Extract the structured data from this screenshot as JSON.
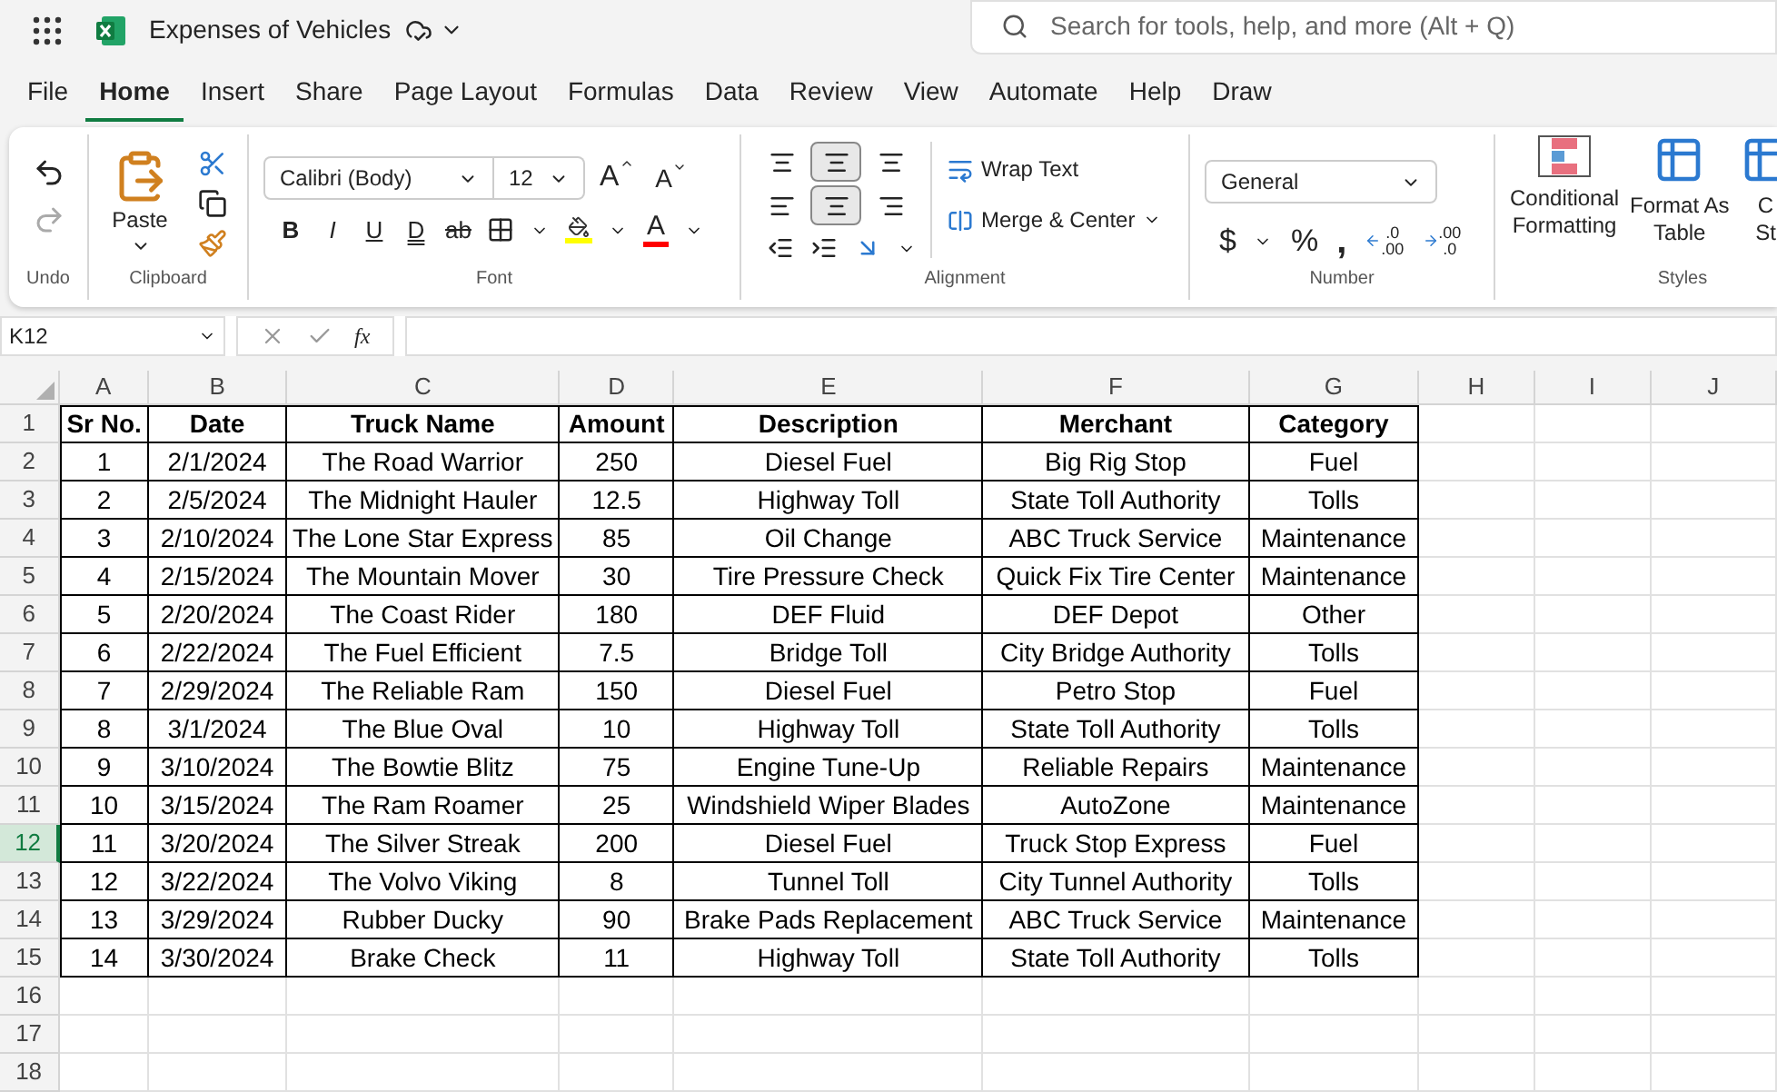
{
  "app": {
    "title": "Expenses of Vehicles"
  },
  "search": {
    "placeholder": "Search for tools, help, and more (Alt + Q)"
  },
  "menu_tabs": [
    {
      "label": "File",
      "selected": false
    },
    {
      "label": "Home",
      "selected": true
    },
    {
      "label": "Insert",
      "selected": false
    },
    {
      "label": "Share",
      "selected": false
    },
    {
      "label": "Page Layout",
      "selected": false
    },
    {
      "label": "Formulas",
      "selected": false
    },
    {
      "label": "Data",
      "selected": false
    },
    {
      "label": "Review",
      "selected": false
    },
    {
      "label": "View",
      "selected": false
    },
    {
      "label": "Automate",
      "selected": false
    },
    {
      "label": "Help",
      "selected": false
    },
    {
      "label": "Draw",
      "selected": false
    }
  ],
  "ribbon": {
    "undo": {
      "label": "Undo"
    },
    "clipboard": {
      "label": "Clipboard",
      "paste": "Paste"
    },
    "font": {
      "label": "Font",
      "font_name": "Calibri (Body)",
      "font_size": "12",
      "grow": "A",
      "shrink": "A",
      "styles": [
        "B",
        "I",
        "U",
        "D",
        "ab"
      ],
      "font_color": "A"
    },
    "alignment": {
      "label": "Alignment",
      "vertical": [
        {
          "selected": false
        },
        {
          "selected": true
        },
        {
          "selected": false
        }
      ],
      "horizontal": [
        {
          "selected": false
        },
        {
          "selected": true
        },
        {
          "selected": false
        }
      ],
      "wrap_text": "Wrap Text",
      "merge": "Merge & Center"
    },
    "number": {
      "label": "Number",
      "format": "General",
      "currency": "$",
      "percent": "%",
      "comma": ",",
      "increase_decimal": [
        ".0",
        ".00"
      ],
      "decrease_decimal": [
        ".00",
        ".0"
      ]
    },
    "styles": {
      "label": "Styles",
      "buttons": [
        {
          "lines": [
            "Conditional",
            "Formatting"
          ]
        },
        {
          "lines": [
            "Format As",
            "Table"
          ]
        },
        {
          "lines": [
            "C",
            "St"
          ]
        }
      ]
    }
  },
  "formula_bar": {
    "name_box": "K12",
    "fx": "fx"
  },
  "sheet": {
    "columns": [
      "A",
      "B",
      "C",
      "D",
      "E",
      "F",
      "G",
      "H",
      "I",
      "J"
    ],
    "rows": [
      {
        "number": "1",
        "selected": false,
        "header": true,
        "cells": [
          "Sr No.",
          "Date",
          "Truck Name",
          "Amount",
          "Description",
          "Merchant",
          "Category"
        ]
      },
      {
        "number": "2",
        "selected": false,
        "cells": [
          "1",
          "2/1/2024",
          "The Road Warrior",
          "250",
          "Diesel Fuel",
          "Big Rig Stop",
          "Fuel"
        ]
      },
      {
        "number": "3",
        "selected": false,
        "cells": [
          "2",
          "2/5/2024",
          "The Midnight Hauler",
          "12.5",
          "Highway Toll",
          "State Toll Authority",
          "Tolls"
        ]
      },
      {
        "number": "4",
        "selected": false,
        "cells": [
          "3",
          "2/10/2024",
          "The Lone Star Express",
          "85",
          "Oil Change",
          "ABC Truck Service",
          "Maintenance"
        ]
      },
      {
        "number": "5",
        "selected": false,
        "cells": [
          "4",
          "2/15/2024",
          "The Mountain Mover",
          "30",
          "Tire Pressure Check",
          "Quick Fix Tire Center",
          "Maintenance"
        ]
      },
      {
        "number": "6",
        "selected": false,
        "cells": [
          "5",
          "2/20/2024",
          "The Coast Rider",
          "180",
          "DEF Fluid",
          "DEF Depot",
          "Other"
        ]
      },
      {
        "number": "7",
        "selected": false,
        "cells": [
          "6",
          "2/22/2024",
          "The Fuel Efficient",
          "7.5",
          "Bridge Toll",
          "City Bridge Authority",
          "Tolls"
        ]
      },
      {
        "number": "8",
        "selected": false,
        "cells": [
          "7",
          "2/29/2024",
          "The Reliable Ram",
          "150",
          "Diesel Fuel",
          "Petro Stop",
          "Fuel"
        ]
      },
      {
        "number": "9",
        "selected": false,
        "cells": [
          "8",
          "3/1/2024",
          "The Blue Oval",
          "10",
          "Highway Toll",
          "State Toll Authority",
          "Tolls"
        ]
      },
      {
        "number": "10",
        "selected": false,
        "cells": [
          "9",
          "3/10/2024",
          "The Bowtie Blitz",
          "75",
          "Engine Tune-Up",
          "Reliable Repairs",
          "Maintenance"
        ]
      },
      {
        "number": "11",
        "selected": false,
        "cells": [
          "10",
          "3/15/2024",
          "The Ram Roamer",
          "25",
          "Windshield Wiper Blades",
          "AutoZone",
          "Maintenance"
        ]
      },
      {
        "number": "12",
        "selected": true,
        "cells": [
          "11",
          "3/20/2024",
          "The Silver Streak",
          "200",
          "Diesel Fuel",
          "Truck Stop Express",
          "Fuel"
        ]
      },
      {
        "number": "13",
        "selected": false,
        "cells": [
          "12",
          "3/22/2024",
          "The Volvo Viking",
          "8",
          "Tunnel Toll",
          "City Tunnel Authority",
          "Tolls"
        ]
      },
      {
        "number": "14",
        "selected": false,
        "cells": [
          "13",
          "3/29/2024",
          "Rubber Ducky",
          "90",
          "Brake Pads Replacement",
          "ABC Truck Service",
          "Maintenance"
        ]
      },
      {
        "number": "15",
        "selected": false,
        "cells": [
          "14",
          "3/30/2024",
          "Brake Check",
          "11",
          "Highway Toll",
          "State Toll Authority",
          "Tolls"
        ]
      },
      {
        "number": "16",
        "selected": false,
        "cells": []
      },
      {
        "number": "17",
        "selected": false,
        "cells": []
      },
      {
        "number": "18",
        "selected": false,
        "cells": []
      }
    ]
  }
}
